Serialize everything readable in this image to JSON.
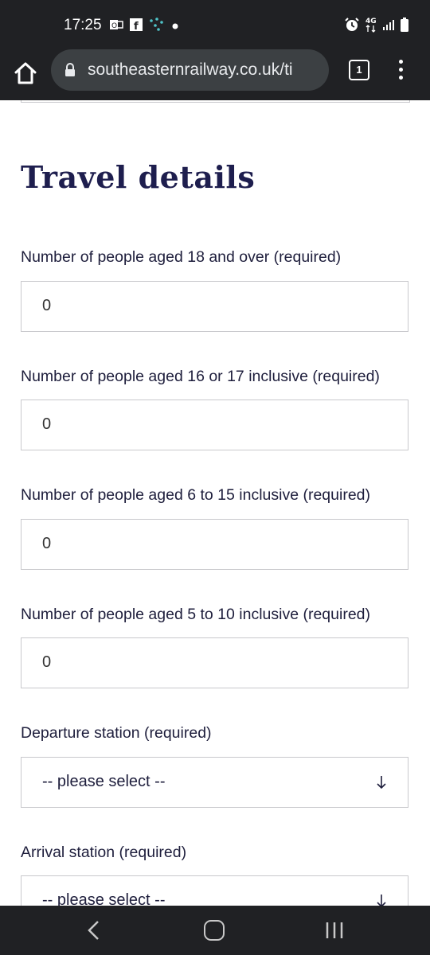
{
  "status_bar": {
    "time": "17:25",
    "network": "4G",
    "icons_left": [
      "outlook-icon",
      "facebook-icon",
      "app-dots-icon",
      "notification-dot-icon"
    ],
    "icons_right": [
      "alarm-icon",
      "4g-icon",
      "signal-icon",
      "battery-icon"
    ]
  },
  "browser": {
    "url": "southeasternrailway.co.uk/ti",
    "tab_count": "1"
  },
  "page": {
    "section_title": "Travel details",
    "fields": [
      {
        "label": "Number of people aged 18 and over (required)",
        "value": "0"
      },
      {
        "label": "Number of people aged 16 or 17 inclusive (required)",
        "value": "0"
      },
      {
        "label": "Number of people aged 6 to 15 inclusive (required)",
        "value": "0"
      },
      {
        "label": "Number of people aged 5 to 10 inclusive (required)",
        "value": "0"
      }
    ],
    "selects": [
      {
        "label": "Departure station (required)",
        "value": "-- please select --"
      },
      {
        "label": "Arrival station (required)",
        "value": "-- please select --"
      }
    ]
  },
  "colors": {
    "heading": "#1e1e4e",
    "text": "#1e1e3c",
    "border": "#c8c8cc",
    "chrome_bg": "#202124"
  }
}
